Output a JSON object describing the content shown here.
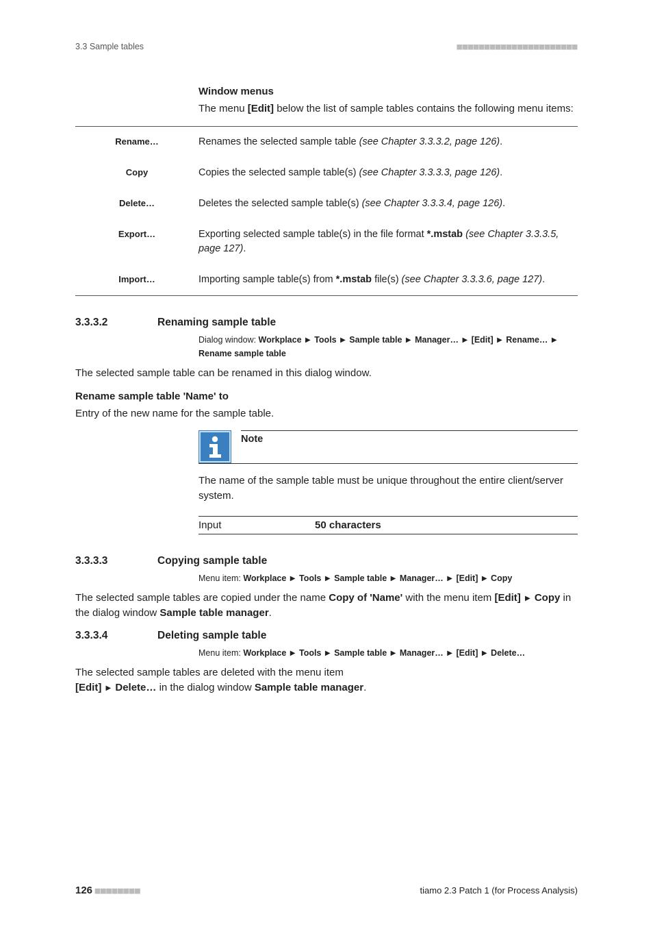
{
  "header": {
    "left": "3.3 Sample tables",
    "right_dots": "■■■■■■■■■■■■■■■■■■■■■■"
  },
  "window_menus": {
    "title": "Window menus",
    "intro_pre": "The menu ",
    "intro_bold": "[Edit]",
    "intro_post": " below the list of sample tables contains the following menu items:"
  },
  "menu_items": [
    {
      "label": "Rename…",
      "desc_pre": "Renames the selected sample table ",
      "desc_em": "(see Chapter 3.3.3.2, page 126)",
      "desc_post": "."
    },
    {
      "label": "Copy",
      "desc_pre": "Copies the selected sample table(s) ",
      "desc_em": "(see Chapter 3.3.3.3, page 126)",
      "desc_post": "."
    },
    {
      "label": "Delete…",
      "desc_pre": "Deletes the selected sample table(s) ",
      "desc_em": "(see Chapter 3.3.3.4, page 126)",
      "desc_post": "."
    },
    {
      "label": "Export…",
      "desc_pre": "Exporting selected sample table(s) in the file format ",
      "desc_bold": "*.mstab",
      "desc_mid": " ",
      "desc_em": "(see Chapter 3.3.3.5, page 127)",
      "desc_post": "."
    },
    {
      "label": "Import…",
      "desc_pre": "Importing sample table(s) from ",
      "desc_bold": "*.mstab",
      "desc_mid": " file(s) ",
      "desc_em": "(see Chapter 3.3.3.6, page 127)",
      "desc_post": "."
    }
  ],
  "sec_3332": {
    "num": "3.3.3.2",
    "title": "Renaming sample table",
    "crumb_label": "Dialog window: ",
    "crumb_parts": [
      "Workplace",
      "Tools",
      "Sample table",
      "Manager…",
      "[Edit]",
      "Rename…",
      "Rename sample table"
    ],
    "body": "The selected sample table can be renamed in this dialog window.",
    "field_label": "Rename sample table 'Name' to",
    "field_desc": "Entry of the new name for the sample table.",
    "note_title": "Note",
    "note_body": "The name of the sample table must be unique throughout the entire client/server system.",
    "input_k": "Input",
    "input_v": "50 characters"
  },
  "sec_3333": {
    "num": "3.3.3.3",
    "title": "Copying sample table",
    "crumb_label": "Menu item: ",
    "crumb_parts": [
      "Workplace",
      "Tools",
      "Sample table",
      "Manager…",
      "[Edit]",
      "Copy"
    ],
    "body_1a": "The selected sample tables are copied under the name ",
    "body_1b": "Copy of 'Name'",
    "body_2a": " with the menu item ",
    "body_2b": "[Edit]",
    "body_2c": "Copy",
    "body_3a": " in the dialog window ",
    "body_3b": "Sample table manager",
    "body_3c": "."
  },
  "sec_3334": {
    "num": "3.3.3.4",
    "title": "Deleting sample table",
    "crumb_label": "Menu item: ",
    "crumb_parts": [
      "Workplace",
      "Tools",
      "Sample table",
      "Manager…",
      "[Edit]",
      "Delete…"
    ],
    "body_1": "The selected sample tables are deleted with the menu item ",
    "body_2a": "[Edit]",
    "body_2b": "Delete…",
    "body_3a": " in the dialog window ",
    "body_3b": "Sample table manager",
    "body_3c": "."
  },
  "footer": {
    "page": "126",
    "left_dots": "■■■■■■■■",
    "product": "tiamo 2.3 Patch 1 (for Process Analysis)"
  }
}
